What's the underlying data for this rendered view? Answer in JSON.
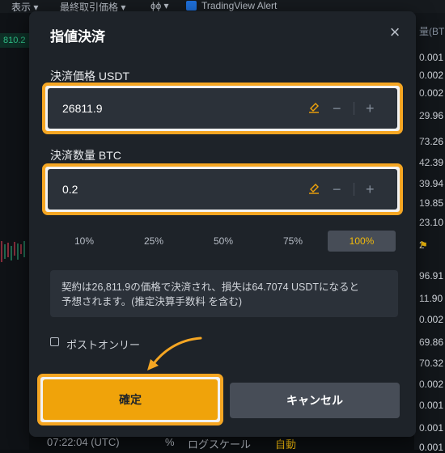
{
  "topbar": {
    "view_label": "表示 ▾",
    "last_price_label": "最終取引価格 ▾",
    "indicator_label": "ɸɸ ▾",
    "tv_alert_label": "TradingView Alert"
  },
  "background": {
    "left_price": "810.2",
    "right_header": "量(BTC",
    "right_values": [
      "0.001",
      "0.002",
      "0.002",
      "29.96",
      "73.26",
      "42.39",
      "39.94",
      "19.85",
      "23.10",
      "2",
      "96.91",
      "11.90",
      "0.002",
      "69.86",
      "70.32",
      "0.002",
      "0.001",
      "0.001",
      "0.001"
    ],
    "flag_label": "⚑",
    "bottom_time": "07:22:04 (UTC)",
    "bottom_pct": "%",
    "bottom_log": "ログスケール",
    "bottom_auto": "自動"
  },
  "dialog": {
    "title": "指値決済",
    "close_icon": "×",
    "price_label": "決済価格 USDT",
    "price_value": "26811.9",
    "qty_label": "決済数量 BTC",
    "qty_value": "0.2",
    "minus": "−",
    "plus": "+",
    "percent_options": [
      "10%",
      "25%",
      "50%",
      "75%",
      "100%"
    ],
    "active_percent": "100%",
    "info_text_line1": "契約は26,811.9の価格で決済され、損失は64.7074 USDTになると",
    "info_text_line2": "予想されます。(推定決算手数料 を含む)",
    "post_only_label": "ポストオンリー",
    "confirm_label": "確定",
    "cancel_label": "キャンセル"
  },
  "colors": {
    "accent": "#f0a30a",
    "highlight": "#f5a623",
    "dialog_bg": "#1e2329",
    "field_bg": "#2b3139"
  }
}
